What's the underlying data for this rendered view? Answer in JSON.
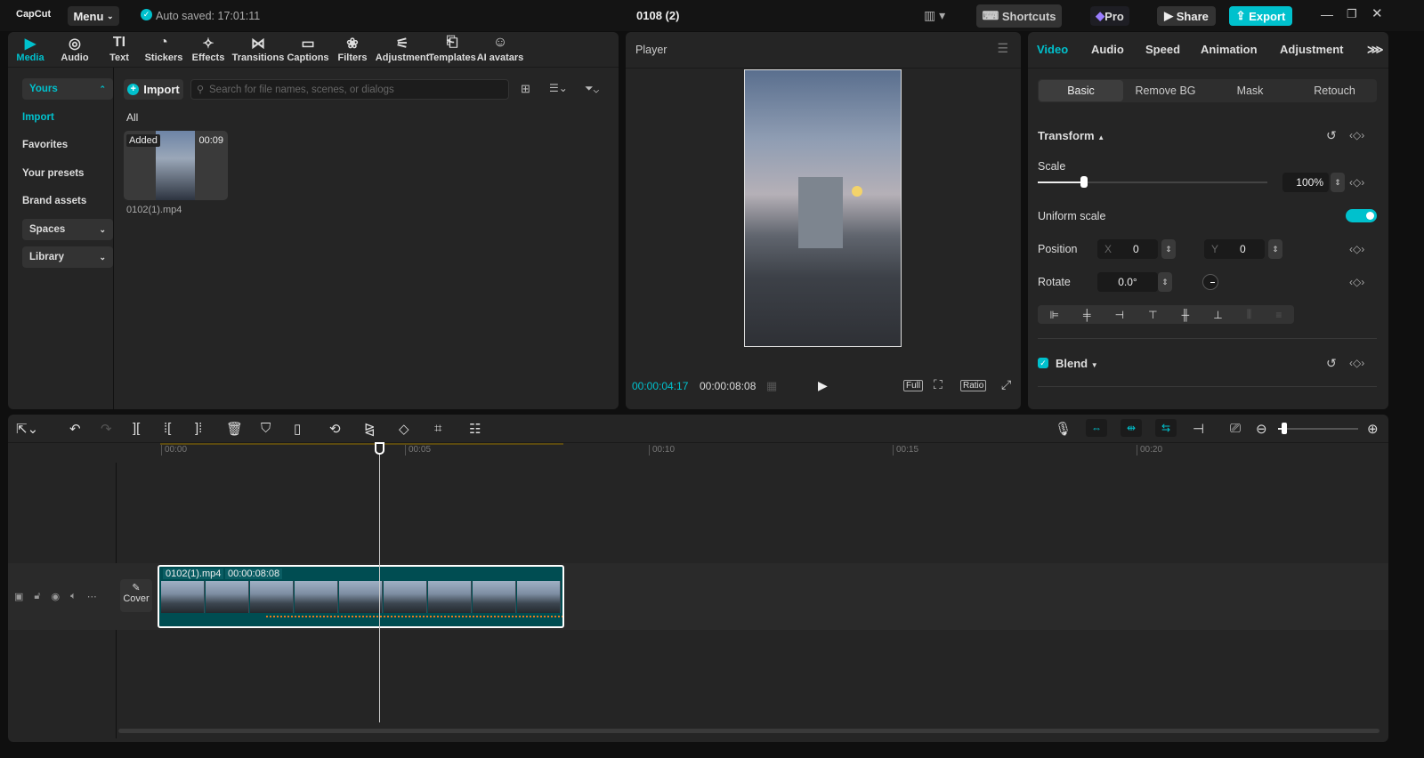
{
  "app": {
    "logo": "CapCut",
    "menu": "Menu",
    "autosave": "Auto saved: 17:01:11",
    "title": "0108 (2)",
    "shortcuts": "Shortcuts",
    "pro": "Pro",
    "share": "Share",
    "export": "Export",
    "accent": "#00c1cd"
  },
  "toolbar": [
    {
      "icon": "media-icon",
      "label": "Media"
    },
    {
      "icon": "audio-icon",
      "label": "Audio"
    },
    {
      "icon": "text-icon",
      "label": "Text"
    },
    {
      "icon": "stickers-icon",
      "label": "Stickers"
    },
    {
      "icon": "effects-icon",
      "label": "Effects"
    },
    {
      "icon": "transitions-icon",
      "label": "Transitions"
    },
    {
      "icon": "captions-icon",
      "label": "Captions"
    },
    {
      "icon": "filters-icon",
      "label": "Filters"
    },
    {
      "icon": "adjustment-icon",
      "label": "Adjustment"
    },
    {
      "icon": "templates-icon",
      "label": "Templates"
    },
    {
      "icon": "ai-avatars-icon",
      "label": "AI avatars"
    }
  ],
  "sidebar": {
    "yours": "Yours",
    "import": "Import",
    "favorites": "Favorites",
    "presets": "Your presets",
    "brand": "Brand assets",
    "spaces": "Spaces",
    "library": "Library"
  },
  "media": {
    "import": "Import",
    "search_placeholder": "Search for file names, scenes, or dialogs",
    "all": "All",
    "item": {
      "badge": "Added",
      "duration": "00:09",
      "name": "0102(1).mp4"
    }
  },
  "player": {
    "title": "Player",
    "current": "00:00:04:17",
    "total": "00:00:08:08",
    "full": "Full",
    "ratio": "Ratio"
  },
  "inspector": {
    "tabs": [
      "Video",
      "Audio",
      "Speed",
      "Animation",
      "Adjustment"
    ],
    "subtabs": [
      "Basic",
      "Remove BG",
      "Mask",
      "Retouch"
    ],
    "transform": "Transform",
    "scale": "Scale",
    "scale_value": "100%",
    "scale_fraction": 0.2,
    "uniform": "Uniform scale",
    "position": "Position",
    "x_label": "X",
    "x": "0",
    "y_label": "Y",
    "y": "0",
    "rotate": "Rotate",
    "rotate_value": "0.0°",
    "blend": "Blend"
  },
  "timeline": {
    "ticks": [
      "00:00",
      "00:05",
      "00:10",
      "00:15",
      "00:20"
    ],
    "cover": "Cover",
    "clip_name": "0102(1).mp4",
    "clip_duration": "00:00:08:08",
    "playhead_seconds": 4.5
  }
}
